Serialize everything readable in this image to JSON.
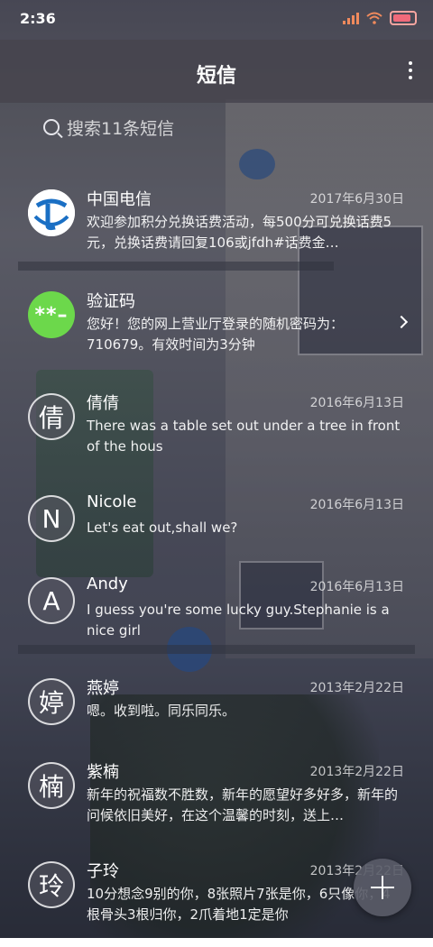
{
  "status_bar": {
    "time": "2:36",
    "icons": [
      "signal-icon",
      "wifi-icon",
      "battery-icon"
    ]
  },
  "header": {
    "title": "短信",
    "menu_icon": "more-vert-icon"
  },
  "search": {
    "placeholder": "搜索11条短信",
    "icon": "search-icon"
  },
  "conversations": [
    {
      "avatar": "",
      "avatar_icon": "china-telecom-logo",
      "name": "中国电信",
      "date": "2017年6月30日",
      "preview": "欢迎参加积分兑换话费活动，每500分可兑换话费5元，兑换话费请回复106或jfdh#话费金…",
      "chevron": false
    },
    {
      "avatar": "**–",
      "name": "验证码",
      "date": "",
      "preview": "您好！您的网上营业厅登录的随机密码为：710679。有效时间为3分钟",
      "chevron": true
    },
    {
      "avatar": "倩",
      "name": "倩倩",
      "date": "2016年6月13日",
      "preview": "There was a table set out under a tree in front of the hous",
      "chevron": false
    },
    {
      "avatar": "N",
      "name": "Nicole",
      "date": "2016年6月13日",
      "preview": "Let's eat out,shall we?",
      "chevron": false
    },
    {
      "avatar": "A",
      "name": "Andy",
      "date": "2016年6月13日",
      "preview": "I guess you're some lucky guy.Stephanie is a nice girl",
      "chevron": false
    },
    {
      "avatar": "婷",
      "name": "燕婷",
      "date": "2013年2月22日",
      "preview": "嗯。收到啦。同乐同乐。",
      "chevron": false
    },
    {
      "avatar": "楠",
      "name": "紫楠",
      "date": "2013年2月22日",
      "preview": "新年的祝福数不胜数，新年的愿望好多好多，新年的问候依旧美好，在这个温馨的时刻，送上…",
      "chevron": false
    },
    {
      "avatar": "玲",
      "name": "子玲",
      "date": "2013年2月22日",
      "preview": "10分想念9别的你，8张照片7张是你，6只像你，4根骨头3根归你，2爪着地1定是你",
      "chevron": false
    }
  ],
  "fab": {
    "icon": "plus-icon"
  }
}
